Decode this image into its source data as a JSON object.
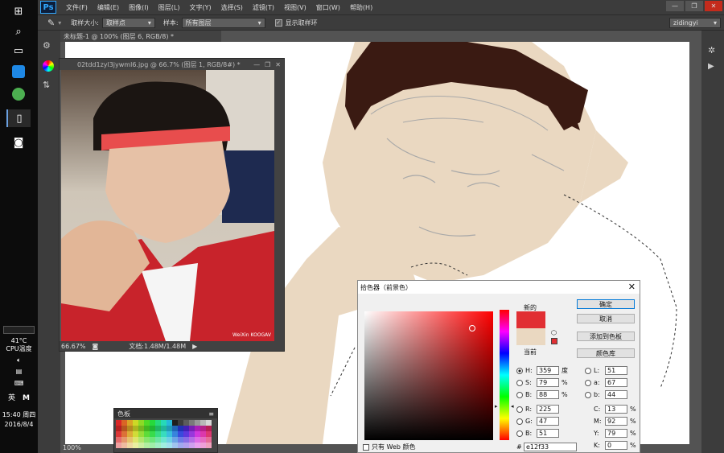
{
  "menubar": {
    "items": [
      "文件(F)",
      "编辑(E)",
      "图像(I)",
      "图层(L)",
      "文字(Y)",
      "选择(S)",
      "滤镜(T)",
      "视图(V)",
      "窗口(W)",
      "帮助(H)"
    ],
    "logo": "Ps"
  },
  "optbar": {
    "sample_size_label": "取样大小:",
    "sample_size_value": "取样点",
    "sample_label": "样本:",
    "sample_value": "所有图层",
    "show_ring_label": "显示取样环",
    "workspace_value": "zidingyi"
  },
  "document": {
    "tab_title": "未标题-1 @ 100% (图层 6, RGB/8) *",
    "zoom": "100%"
  },
  "photo": {
    "title": "02tdd1zyl3jywml6.jpg @ 66.7% (图层 1, RGB/8#) *",
    "zoom": "66.67%",
    "doc_info": "文档:1.48M/1.48M",
    "watermark": "WeiXin KOOGAV"
  },
  "swatches": {
    "tab_label": "色板"
  },
  "picker": {
    "title": "拾色器（前景色）",
    "new_label": "新的",
    "current_label": "当前",
    "ok_label": "确定",
    "cancel_label": "取消",
    "add_swatch_label": "添加到色板",
    "libraries_label": "颜色库",
    "web_only_label": "只有 Web 颜色",
    "hash": "#",
    "hex": "e12f33",
    "new_color": "#e12f33",
    "current_color": "#ead8c1",
    "fields": {
      "H": {
        "label": "H:",
        "value": "359",
        "unit": "度"
      },
      "S": {
        "label": "S:",
        "value": "79",
        "unit": "%"
      },
      "Bv": {
        "label": "B:",
        "value": "88",
        "unit": "%"
      },
      "R": {
        "label": "R:",
        "value": "225",
        "unit": ""
      },
      "G": {
        "label": "G:",
        "value": "47",
        "unit": ""
      },
      "Bc": {
        "label": "B:",
        "value": "51",
        "unit": ""
      },
      "L": {
        "label": "L:",
        "value": "51",
        "unit": ""
      },
      "a": {
        "label": "a:",
        "value": "67",
        "unit": ""
      },
      "b": {
        "label": "b:",
        "value": "44",
        "unit": ""
      },
      "C": {
        "label": "C:",
        "value": "13",
        "unit": "%"
      },
      "M": {
        "label": "M:",
        "value": "92",
        "unit": "%"
      },
      "Y": {
        "label": "Y:",
        "value": "79",
        "unit": "%"
      },
      "K": {
        "label": "K:",
        "value": "0",
        "unit": "%"
      }
    }
  },
  "tray": {
    "temp": "41°C",
    "cpu_label": "CPU温度",
    "ime": "英",
    "time": "15:40 周四",
    "date": "2016/8/4"
  }
}
